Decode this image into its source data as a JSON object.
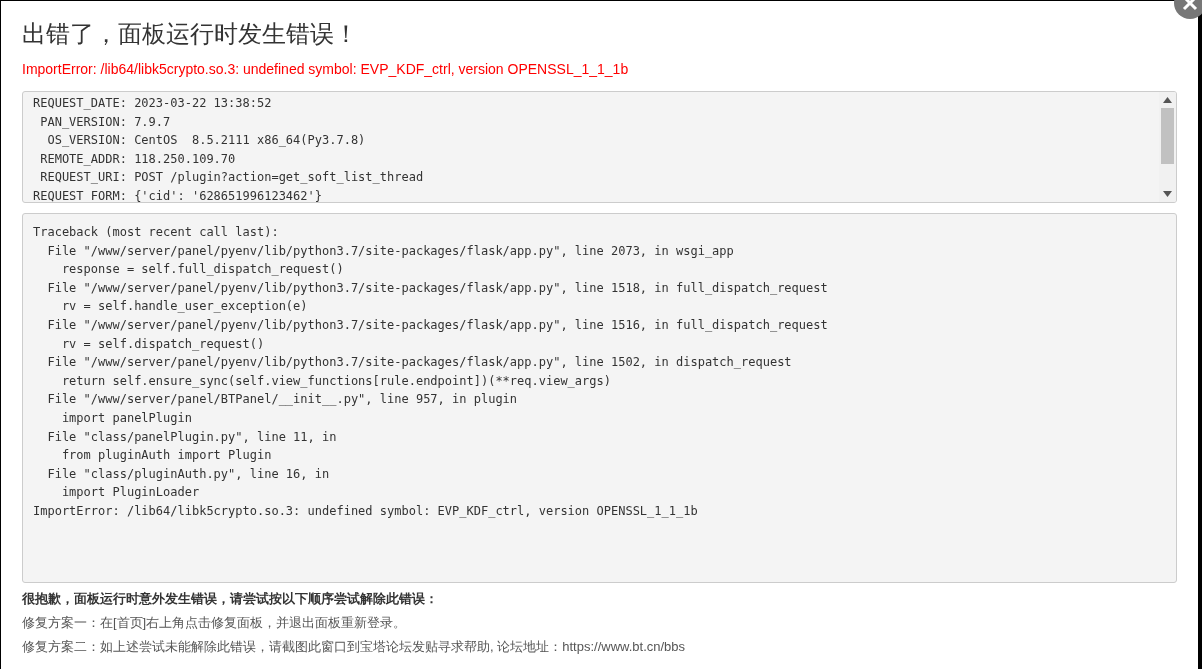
{
  "dialog": {
    "title": "出错了，面板运行时发生错误！",
    "error_message": "ImportError: /lib64/libk5crypto.so.3: undefined symbol: EVP_KDF_ctrl, version OPENSSL_1_1_1b"
  },
  "request_info": {
    "lines": [
      "REQUEST_DATE: 2023-03-22 13:38:52",
      " PAN_VERSION: 7.9.7",
      "  OS_VERSION: CentOS  8.5.2111 x86_64(Py3.7.8)",
      " REMOTE_ADDR: 118.250.109.70",
      " REQUEST_URI: POST /plugin?action=get_soft_list_thread",
      "REQUEST FORM: {'cid': '628651996123462'}"
    ]
  },
  "traceback": {
    "lines": [
      "Traceback (most recent call last):",
      "  File \"/www/server/panel/pyenv/lib/python3.7/site-packages/flask/app.py\", line 2073, in wsgi_app",
      "    response = self.full_dispatch_request()",
      "  File \"/www/server/panel/pyenv/lib/python3.7/site-packages/flask/app.py\", line 1518, in full_dispatch_request",
      "    rv = self.handle_user_exception(e)",
      "  File \"/www/server/panel/pyenv/lib/python3.7/site-packages/flask/app.py\", line 1516, in full_dispatch_request",
      "    rv = self.dispatch_request()",
      "  File \"/www/server/panel/pyenv/lib/python3.7/site-packages/flask/app.py\", line 1502, in dispatch_request",
      "    return self.ensure_sync(self.view_functions[rule.endpoint])(**req.view_args)",
      "  File \"/www/server/panel/BTPanel/__init__.py\", line 957, in plugin",
      "    import panelPlugin",
      "  File \"class/panelPlugin.py\", line 11, in",
      "    from pluginAuth import Plugin",
      "  File \"class/pluginAuth.py\", line 16, in",
      "    import PluginLoader",
      "ImportError: /lib64/libk5crypto.so.3: undefined symbol: EVP_KDF_ctrl, version OPENSSL_1_1_1b"
    ]
  },
  "help": {
    "heading": "很抱歉，面板运行时意外发生错误，请尝试按以下顺序尝试解除此错误：",
    "fixes": [
      "修复方案一：在[首页]右上角点击修复面板，并退出面板重新登录。",
      "修复方案二：如上述尝试未能解除此错误，请截图此窗口到宝塔论坛发贴寻求帮助, 论坛地址：https://www.bt.cn/bbs"
    ]
  }
}
